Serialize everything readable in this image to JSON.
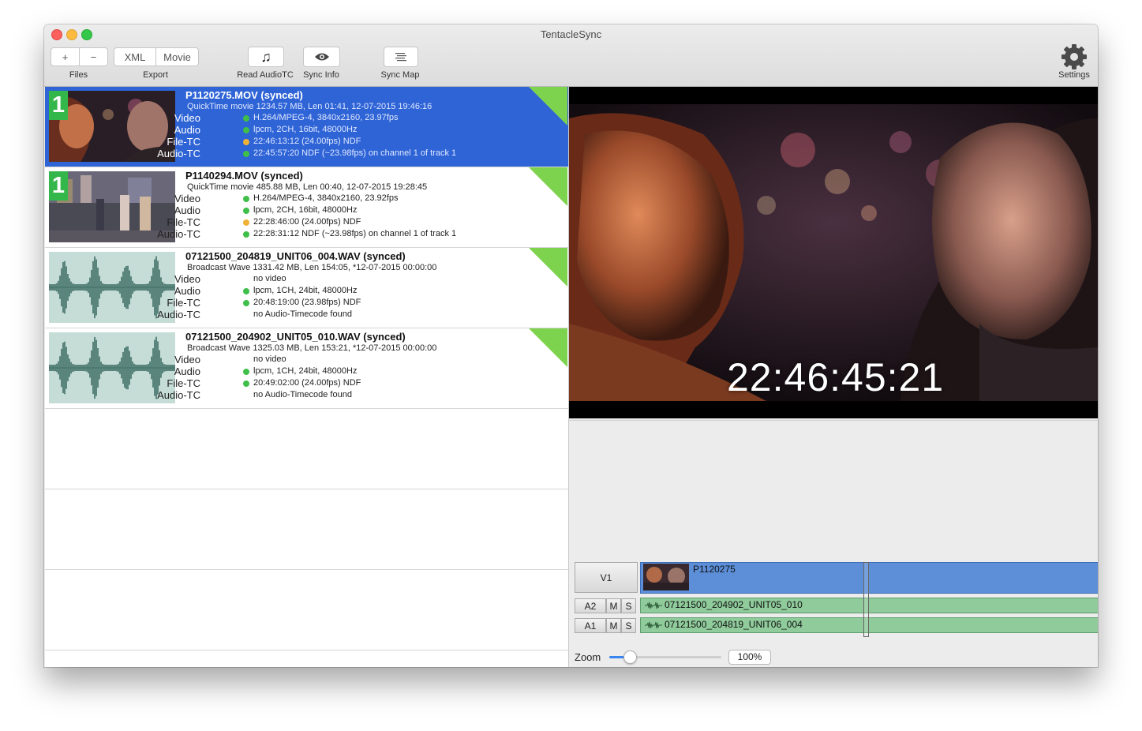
{
  "window": {
    "title": "TentacleSync"
  },
  "toolbar": {
    "add_label": "+",
    "remove_label": "−",
    "files_label": "Files",
    "xml_label": "XML",
    "movie_label": "Movie",
    "export_label": "Export",
    "read_audiotc_label": "Read AudioTC",
    "sync_info_label": "Sync Info",
    "sync_map_label": "Sync Map",
    "settings_label": "Settings"
  },
  "colors": {
    "selection": "#2f64d6",
    "status_green": "#3fbf49",
    "status_orange": "#f0b236",
    "synced_corner": "#7dd24e",
    "badge_green": "#34b74a"
  },
  "files": [
    {
      "title": "P1120275.MOV (synced)",
      "subtitle": "QuickTime movie 1234.57 MB, Len 01:41, 12-07-2015 19:46:16",
      "badge": "1",
      "thumb": "video",
      "selected": true,
      "fields": [
        {
          "key": "Video",
          "dot": "green",
          "value": "H.264/MPEG-4, 3840x2160, 23.97fps"
        },
        {
          "key": "Audio",
          "dot": "green",
          "value": "lpcm, 2CH, 16bit, 48000Hz"
        },
        {
          "key": "File-TC",
          "dot": "orange",
          "value": "22:46:13:12 (24.00fps) NDF"
        },
        {
          "key": "Audio-TC",
          "dot": "green",
          "value": "22:45:57:20 NDF (~23.98fps) on channel 1 of track 1"
        }
      ]
    },
    {
      "title": "P1140294.MOV (synced)",
      "subtitle": "QuickTime movie 485.88 MB, Len 00:40, 12-07-2015 19:28:45",
      "badge": "1",
      "thumb": "video",
      "selected": false,
      "fields": [
        {
          "key": "Video",
          "dot": "green",
          "value": "H.264/MPEG-4, 3840x2160, 23.92fps"
        },
        {
          "key": "Audio",
          "dot": "green",
          "value": "lpcm, 2CH, 16bit, 48000Hz"
        },
        {
          "key": "File-TC",
          "dot": "orange",
          "value": "22:28:46:00 (24.00fps) NDF"
        },
        {
          "key": "Audio-TC",
          "dot": "green",
          "value": "22:28:31:12 NDF (~23.98fps) on channel 1 of track 1"
        }
      ]
    },
    {
      "title": "07121500_204819_UNIT06_004.WAV (synced)",
      "subtitle": "Broadcast Wave 1331.42 MB, Len 154:05, *12-07-2015 00:00:00",
      "badge": "",
      "thumb": "wave",
      "selected": false,
      "fields": [
        {
          "key": "Video",
          "dot": "",
          "value": "no video"
        },
        {
          "key": "Audio",
          "dot": "green",
          "value": "lpcm, 1CH, 24bit, 48000Hz"
        },
        {
          "key": "File-TC",
          "dot": "green",
          "value": "20:48:19:00 (23.98fps) NDF"
        },
        {
          "key": "Audio-TC",
          "dot": "",
          "value": "no Audio-Timecode found"
        }
      ]
    },
    {
      "title": "07121500_204902_UNIT05_010.WAV (synced)",
      "subtitle": "Broadcast Wave 1325.03 MB, Len 153:21, *12-07-2015 00:00:00",
      "badge": "",
      "thumb": "wave",
      "selected": false,
      "fields": [
        {
          "key": "Video",
          "dot": "",
          "value": "no video"
        },
        {
          "key": "Audio",
          "dot": "green",
          "value": "lpcm, 1CH, 24bit, 48000Hz"
        },
        {
          "key": "File-TC",
          "dot": "green",
          "value": "20:49:02:00 (24.00fps) NDF"
        },
        {
          "key": "Audio-TC",
          "dot": "",
          "value": "no Audio-Timecode found"
        }
      ]
    }
  ],
  "preview": {
    "timecode": "22:46:45:21"
  },
  "timeline": {
    "v1": {
      "label": "V1",
      "clip": "P1120275"
    },
    "a2": {
      "label": "A2",
      "mute": "M",
      "solo": "S",
      "clip": "07121500_204902_UNIT05_010"
    },
    "a1": {
      "label": "A1",
      "mute": "M",
      "solo": "S",
      "clip": "07121500_204819_UNIT06_004"
    }
  },
  "zoom": {
    "label": "Zoom",
    "value_text": "100%",
    "level": 0.18
  }
}
